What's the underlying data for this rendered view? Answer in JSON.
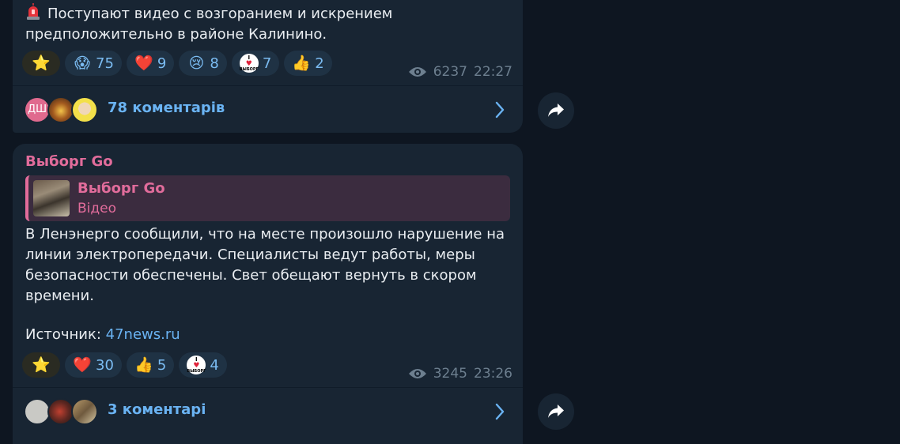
{
  "posts": [
    {
      "text": "Поступают видео с возгоранием и искрением предположительно в районе Калинино.",
      "reactions": [
        {
          "icon": "star-icon",
          "emoji": "⭐",
          "count": ""
        },
        {
          "icon": "scream-icon",
          "emoji": "😱",
          "count": "75"
        },
        {
          "icon": "heart-icon",
          "emoji": "❤️",
          "count": "9"
        },
        {
          "icon": "crying-icon",
          "emoji": "😢",
          "count": "8"
        },
        {
          "icon": "i-love-vyborg-icon",
          "emoji": "",
          "count": "7"
        },
        {
          "icon": "thumbs-up-icon",
          "emoji": "👍",
          "count": "2"
        }
      ],
      "views": "6237",
      "time": "22:27",
      "comments_label": "78 коментарів",
      "avatar_initials": "ДШ"
    },
    {
      "channel": "Выборг Go",
      "quote_title": "Выборг Go",
      "quote_subtitle": "Відео",
      "text": "В Ленэнерго сообщили, что на месте произошло нарушение на линии электропередачи. Специалисты ведут работы, меры безопасности обеспечены. Свет обещают вернуть в скором времени.",
      "source_label": "Источник:",
      "source_link": "47news.ru",
      "reactions": [
        {
          "icon": "star-icon",
          "emoji": "⭐",
          "count": ""
        },
        {
          "icon": "heart-icon",
          "emoji": "❤️",
          "count": "30"
        },
        {
          "icon": "thumbs-up-icon",
          "emoji": "👍",
          "count": "5"
        },
        {
          "icon": "i-love-vyborg-icon",
          "emoji": "",
          "count": "4"
        }
      ],
      "views": "3245",
      "time": "23:26",
      "comments_label": "3 коментарі"
    }
  ],
  "badge": {
    "top": "I",
    "bottom": "ВЫБОРГ"
  },
  "colors": {
    "background": "#0e1621",
    "bubble": "#182533",
    "accent_link": "#6ab3f3",
    "channel_pink": "#e16c9b"
  }
}
